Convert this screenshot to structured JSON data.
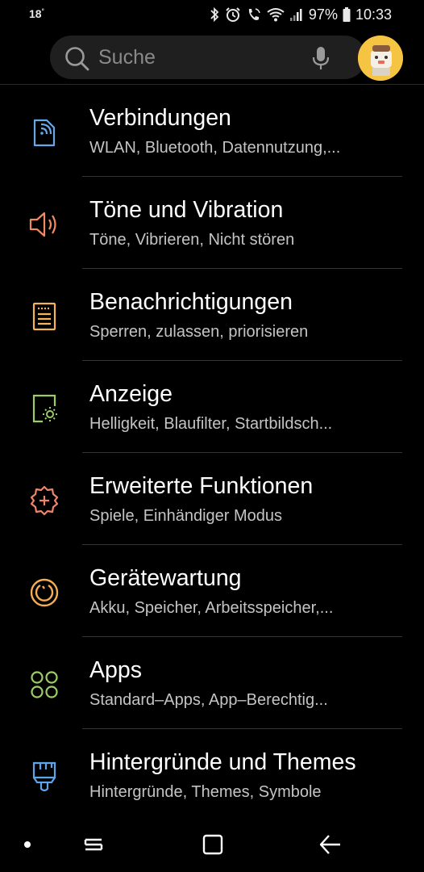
{
  "status_bar": {
    "temperature": "18",
    "temperature_unit": "°",
    "battery": "97%",
    "time": "10:33",
    "icons": [
      "bluetooth-icon",
      "alarm-icon",
      "call-icon",
      "wifi-icon",
      "signal-icon",
      "battery-icon"
    ]
  },
  "search": {
    "placeholder": "Suche",
    "icon": "search-icon",
    "mic_icon": "mic-icon"
  },
  "settings": [
    {
      "title": "Verbindungen",
      "subtitle": "WLAN, Bluetooth, Datennutzung,...",
      "icon": "connections-icon",
      "color": "#6aa7e6"
    },
    {
      "title": "Töne und Vibration",
      "subtitle": "Töne, Vibrieren, Nicht stören",
      "icon": "speaker-icon",
      "color": "#f08a61"
    },
    {
      "title": "Benachrichtigungen",
      "subtitle": "Sperren, zulassen, priorisieren",
      "icon": "notifications-icon",
      "color": "#f5b35a"
    },
    {
      "title": "Anzeige",
      "subtitle": "Helligkeit, Blaufilter, Startbildsch...",
      "icon": "display-icon",
      "color": "#9ccc65"
    },
    {
      "title": "Erweiterte Funktionen",
      "subtitle": "Spiele, Einhändiger Modus",
      "icon": "advanced-features-icon",
      "color": "#f0846a"
    },
    {
      "title": "Gerätewartung",
      "subtitle": "Akku, Speicher, Arbeitsspeicher,...",
      "icon": "device-care-icon",
      "color": "#f5ad52"
    },
    {
      "title": "Apps",
      "subtitle": "Standard–Apps, App–Berechtig...",
      "icon": "apps-icon",
      "color": "#9ccc65"
    },
    {
      "title": "Hintergründe und Themes",
      "subtitle": "Hintergründe, Themes, Symbole",
      "icon": "themes-icon",
      "color": "#5fa3e8"
    }
  ],
  "nav_bar": {
    "icons": [
      "recent-apps-icon",
      "home-icon",
      "back-icon"
    ]
  }
}
